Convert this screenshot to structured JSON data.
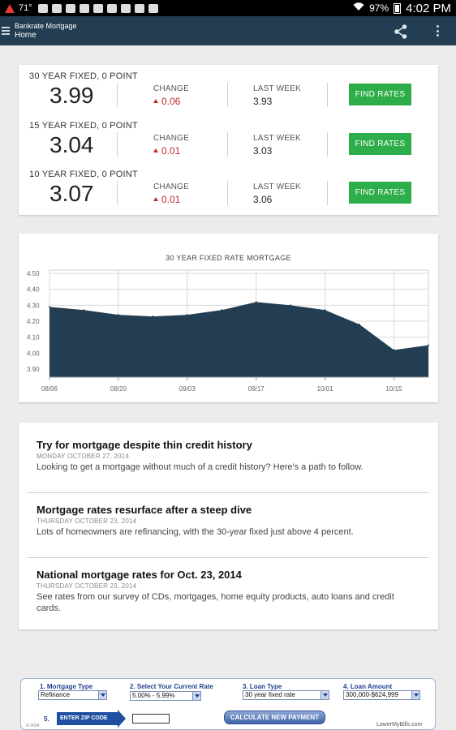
{
  "status_bar": {
    "temperature": "71°",
    "battery": "97%",
    "time": "4:02 PM"
  },
  "app_bar": {
    "title": "Bankrate Mortgage",
    "subtitle": "Home"
  },
  "rates": {
    "change_label": "CHANGE",
    "last_week_label": "LAST WEEK",
    "button_label": "FIND RATES",
    "rows": [
      {
        "label": "30 YEAR FIXED, 0 POINT",
        "rate": "3.99",
        "change": "0.06",
        "last_week": "3.93"
      },
      {
        "label": "15 YEAR FIXED, 0 POINT",
        "rate": "3.04",
        "change": "0.01",
        "last_week": "3.03"
      },
      {
        "label": "10 YEAR FIXED, 0 POINT",
        "rate": "3.07",
        "change": "0.01",
        "last_week": "3.06"
      }
    ]
  },
  "chart_data": {
    "type": "area",
    "title": "30 YEAR FIXED RATE MORTGAGE",
    "xlabel": "",
    "ylabel": "",
    "x_tick_labels": [
      "08/06",
      "08/20",
      "09/03",
      "09/17",
      "10/01",
      "10/15"
    ],
    "x": [
      "08/06",
      "08/13",
      "08/20",
      "08/27",
      "09/03",
      "09/10",
      "09/17",
      "09/24",
      "10/01",
      "10/08",
      "10/15",
      "10/22"
    ],
    "values": [
      4.29,
      4.27,
      4.24,
      4.23,
      4.24,
      4.27,
      4.32,
      4.3,
      4.27,
      4.18,
      4.02,
      4.05
    ],
    "y_ticks": [
      "4.50",
      "4.40",
      "4.30",
      "4.20",
      "4.10",
      "4.00",
      "3.90"
    ],
    "ylim": [
      3.85,
      4.52
    ],
    "fill_color": "#233e52",
    "grid": true
  },
  "news": [
    {
      "title": "Try for mortgage despite thin credit history",
      "date": "MONDAY OCTOBER 27, 2014",
      "description": "Looking to get a mortgage without much of a credit history? Here's a path to follow."
    },
    {
      "title": "Mortgage rates resurface after a steep dive",
      "date": "THURSDAY OCTOBER 23, 2014",
      "description": "Lots of homeowners are refinancing, with the 30-year fixed just above 4 percent."
    },
    {
      "title": "National mortgage rates for Oct. 23, 2014",
      "date": "THURSDAY OCTOBER 23, 2014",
      "description": "See rates from our survey of CDs, mortgages, home equity products, auto loans and credit cards."
    }
  ],
  "ad": {
    "step1_label": "1. Mortgage Type",
    "step1_value": "Refinance",
    "step2_label": "2. Select Your Current Rate",
    "step2_value": "5.00% - 5.99%",
    "step3_label": "3. Loan Type",
    "step3_value": "30 year fixed rate",
    "step4_label": "4. Loan Amount",
    "step4_value": "300,000-$624,999",
    "step5_label": "5.",
    "zip_label": "ENTER ZIP CODE",
    "calc_label": "CALCULATE NEW PAYMENT",
    "copyright": "© 2014",
    "brand": "LowerMyBills.com"
  }
}
